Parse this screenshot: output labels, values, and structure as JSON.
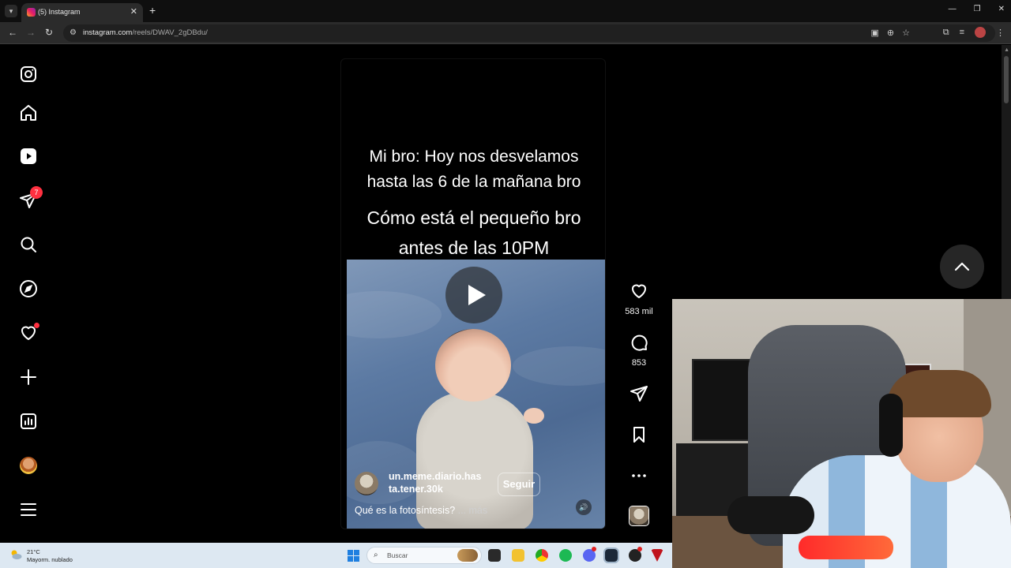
{
  "browser": {
    "tab_title": "(5) Instagram",
    "url_host": "instagram.com",
    "url_path": "/reels/DWAV_2gDBdu/"
  },
  "sidebar": {
    "notifications_badge": "7",
    "items": [
      {
        "name": "instagram-logo-icon",
        "label": "Instagram"
      },
      {
        "name": "home-icon",
        "label": "Home"
      },
      {
        "name": "reels-icon",
        "label": "Reels"
      },
      {
        "name": "direct-messages-icon",
        "label": "Messages"
      },
      {
        "name": "search-icon",
        "label": "Search"
      },
      {
        "name": "explore-icon",
        "label": "Explore"
      },
      {
        "name": "notifications-heart-icon",
        "label": "Notifications"
      },
      {
        "name": "create-plus-icon",
        "label": "Create"
      },
      {
        "name": "dashboard-icon",
        "label": "Dashboard"
      },
      {
        "name": "profile-avatar",
        "label": "Profile"
      },
      {
        "name": "more-menu-icon",
        "label": "More"
      }
    ]
  },
  "reel": {
    "overlay_line1": "Mi bro: Hoy nos desvelamos",
    "overlay_line2": "hasta las 6 de la mañana bro",
    "overlay_line3": "Cómo está el pequeño bro",
    "overlay_line4": "antes de las 10PM",
    "author_line1": "un.meme.diario.has",
    "author_line2": "ta.tener.30k",
    "follow_label": "Seguir",
    "caption": "Qué es la fotosíntesis?",
    "caption_more": " ... más"
  },
  "actions": {
    "likes": "583 mil",
    "comments": "853"
  },
  "taskbar": {
    "temperature": "21°C",
    "weather": "Mayorm. nublado",
    "search_placeholder": "Buscar"
  },
  "colors": {
    "instagram_bg": "#000000",
    "badge_red": "#ff3040",
    "taskbar_bg": "#dde8f2"
  }
}
